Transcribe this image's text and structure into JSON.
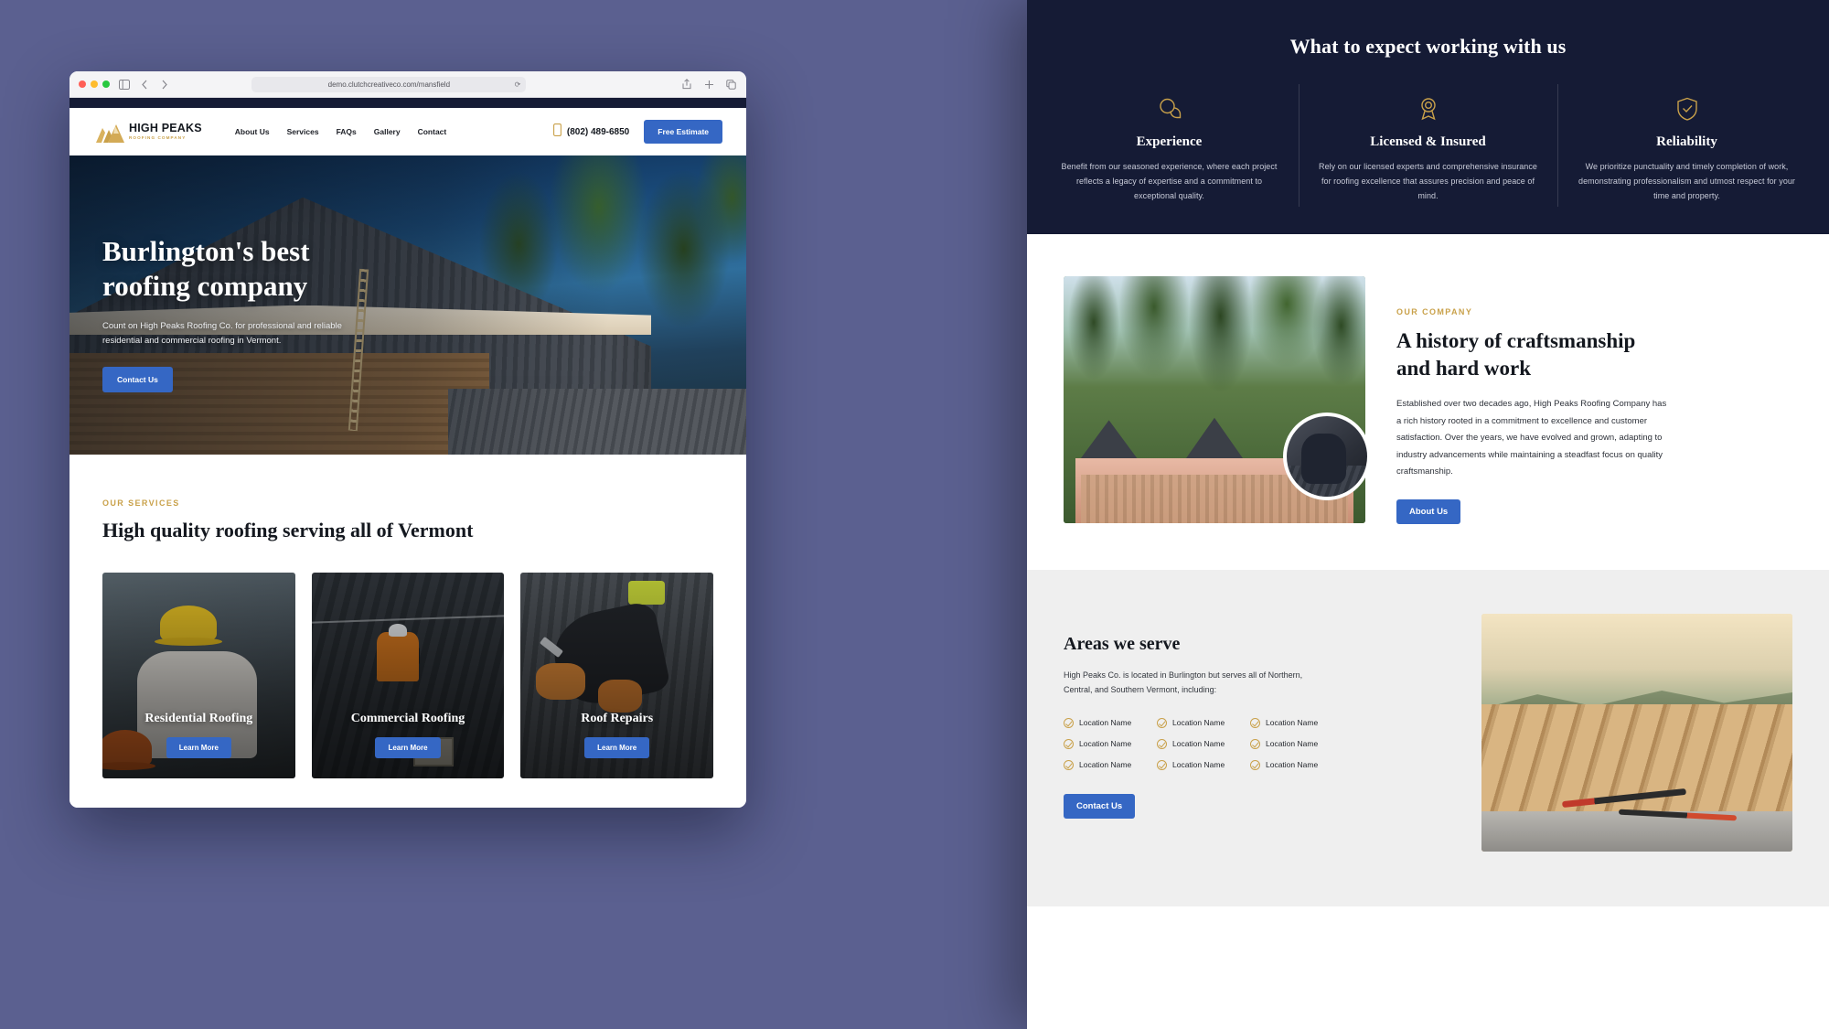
{
  "browser": {
    "url": "demo.clutchcreativeco.com/mansfield",
    "reload_icon": "reload-icon",
    "traffic_lights": [
      "close",
      "minimize",
      "maximize"
    ],
    "sidebar_icon": "sidebar-icon",
    "back_icon": "chevron-left-icon",
    "forward_icon": "chevron-right-icon",
    "share_icon": "share-icon",
    "newtab_icon": "plus-icon",
    "tabs_icon": "copy-tabs-icon"
  },
  "site": {
    "logo": {
      "name": "HIGH PEAKS",
      "tagline": "ROOFING COMPANY"
    },
    "nav": [
      {
        "label": "About Us"
      },
      {
        "label": "Services"
      },
      {
        "label": "FAQs"
      },
      {
        "label": "Gallery"
      },
      {
        "label": "Contact"
      }
    ],
    "phone": "(802) 489-6850",
    "cta": "Free Estimate"
  },
  "hero": {
    "heading_line1": "Burlington's best",
    "heading_line2": "roofing company",
    "paragraph": "Count on High Peaks Roofing Co. for professional and reliable residential and commercial roofing in Vermont.",
    "button": "Contact Us"
  },
  "services": {
    "eyebrow": "OUR SERVICES",
    "heading": "High quality roofing serving all of Vermont",
    "cards": [
      {
        "title": "Residential Roofing",
        "button": "Learn More"
      },
      {
        "title": "Commercial Roofing",
        "button": "Learn More"
      },
      {
        "title": "Roof Repairs",
        "button": "Learn More"
      }
    ]
  },
  "expect": {
    "title": "What to expect working with us",
    "items": [
      {
        "icon": "speech-bubbles-icon",
        "title": "Experience",
        "text": "Benefit from our seasoned experience, where each project reflects a legacy of expertise and a commitment to exceptional quality."
      },
      {
        "icon": "award-ribbon-icon",
        "title": "Licensed & Insured",
        "text": "Rely on our licensed experts and comprehensive insurance for roofing excellence that assures precision and peace of mind."
      },
      {
        "icon": "shield-check-icon",
        "title": "Reliability",
        "text": "We prioritize punctuality and timely completion of work, demonstrating professionalism and utmost respect for your time and property."
      }
    ]
  },
  "history": {
    "eyebrow": "OUR COMPANY",
    "heading_line1": "A history of craftsmanship",
    "heading_line2": "and hard work",
    "paragraph": "Established over two decades ago, High Peaks Roofing Company has a rich history rooted in a commitment to excellence and customer satisfaction. Over the years, we have evolved and grown, adapting to industry advancements while maintaining a steadfast focus on quality craftsmanship.",
    "button": "About Us"
  },
  "areas": {
    "heading": "Areas we serve",
    "paragraph": "High Peaks Co. is located in Burlington but serves all of Northern, Central, and Southern Vermont, including:",
    "locations": [
      "Location Name",
      "Location Name",
      "Location Name",
      "Location Name",
      "Location Name",
      "Location Name",
      "Location Name",
      "Location Name",
      "Location Name"
    ],
    "button": "Contact Us"
  },
  "colors": {
    "navy": "#151b35",
    "gold": "#c9a14a",
    "blue": "#3567c4",
    "page_bg": "#5b6090"
  }
}
